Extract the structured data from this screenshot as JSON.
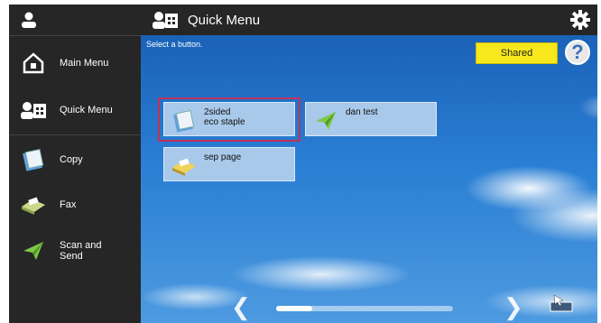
{
  "header": {
    "title": "Quick Menu"
  },
  "sidebar": {
    "items": [
      {
        "label": "Main Menu"
      },
      {
        "label": "Quick Menu"
      },
      {
        "label": "Copy"
      },
      {
        "label": "Fax"
      },
      {
        "label": "Scan and\nSend"
      }
    ]
  },
  "main": {
    "prompt": "Select a button.",
    "shared_label": "Shared",
    "help_label": "?",
    "buttons": [
      {
        "label": "2sided\neco staple",
        "icon": "copy-icon",
        "selected": true
      },
      {
        "label": "dan test",
        "icon": "send-icon"
      },
      {
        "label": "sep page",
        "icon": "fax-icon"
      }
    ],
    "scrollbar_position": 0.0
  },
  "colors": {
    "selection_border": "#c0325a",
    "shared_button": "#f8e71c",
    "tile": "#a9c9ea"
  }
}
